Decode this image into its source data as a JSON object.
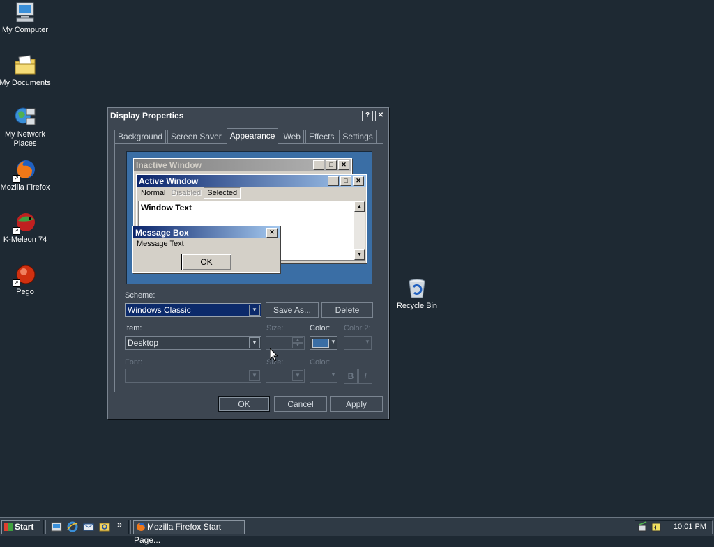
{
  "desktop": {
    "icons": [
      {
        "label": "My Computer"
      },
      {
        "label": "My Documents"
      },
      {
        "label": "My Network Places"
      },
      {
        "label": "Mozilla Firefox"
      },
      {
        "label": "K-Meleon 74"
      },
      {
        "label": "Pego"
      },
      {
        "label": "Recycle Bin"
      }
    ]
  },
  "dialog": {
    "title": "Display Properties",
    "tabs": [
      "Background",
      "Screen Saver",
      "Appearance",
      "Web",
      "Effects",
      "Settings"
    ],
    "active_tab": "Appearance",
    "preview": {
      "inactive_title": "Inactive Window",
      "active_title": "Active Window",
      "menu_normal": "Normal",
      "menu_disabled": "Disabled",
      "menu_selected": "Selected",
      "window_text": "Window Text",
      "msgbox_title": "Message Box",
      "msgbox_text": "Message Text",
      "msgbox_ok": "OK"
    },
    "scheme_label": "Scheme:",
    "scheme_value": "Windows Classic",
    "save_as": "Save As...",
    "delete": "Delete",
    "item_label": "Item:",
    "item_value": "Desktop",
    "size_label": "Size:",
    "color_label": "Color:",
    "color2_label": "Color 2:",
    "font_label": "Font:",
    "font_size_label": "Size:",
    "font_color_label": "Color:",
    "bold_label": "B",
    "italic_label": "I",
    "ok": "OK",
    "cancel": "Cancel",
    "apply": "Apply",
    "colors": {
      "desktop_color": "#3a6ea5"
    }
  },
  "taskbar": {
    "start": "Start",
    "chevron": "»",
    "task": "Mozilla Firefox Start Page...",
    "clock": "10:01 PM"
  }
}
